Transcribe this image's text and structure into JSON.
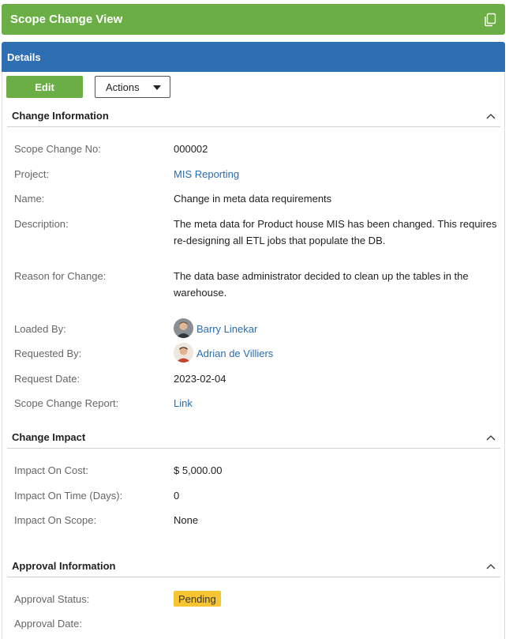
{
  "header": {
    "title": "Scope Change View",
    "copy_icon": "copy-icon"
  },
  "panel": {
    "title": "Details"
  },
  "toolbar": {
    "edit_label": "Edit",
    "actions_label": "Actions"
  },
  "sections": {
    "change_info": {
      "title": "Change Information",
      "rows": {
        "scope_change_no": {
          "label": "Scope Change No:",
          "value": "000002"
        },
        "project": {
          "label": "Project:",
          "value": "MIS Reporting"
        },
        "name": {
          "label": "Name:",
          "value": "Change in meta data requirements"
        },
        "description": {
          "label": "Description:",
          "value": "The meta data for Product house MIS has been changed. This requires re-designing all ETL jobs that populate the DB."
        },
        "reason": {
          "label": "Reason for Change:",
          "value": "The data base administrator decided to clean up the tables in the warehouse."
        },
        "loaded_by": {
          "label": "Loaded By:",
          "value": "Barry Linekar"
        },
        "requested_by": {
          "label": "Requested By:",
          "value": "Adrian de Villiers"
        },
        "request_date": {
          "label": "Request Date:",
          "value": "2023-02-04"
        },
        "report": {
          "label": "Scope Change Report:",
          "value": "Link"
        }
      }
    },
    "impact": {
      "title": "Change Impact",
      "rows": {
        "cost": {
          "label": "Impact On Cost:",
          "value": "$ 5,000.00"
        },
        "time": {
          "label": "Impact On Time (Days):",
          "value": "0"
        },
        "scope": {
          "label": "Impact On Scope:",
          "value": "None"
        }
      }
    },
    "approval": {
      "title": "Approval Information",
      "rows": {
        "status": {
          "label": "Approval Status:",
          "value": "Pending"
        },
        "date": {
          "label": "Approval Date:",
          "value": ""
        }
      }
    }
  },
  "colors": {
    "header_green": "#6aae45",
    "panel_blue": "#2e6eb2",
    "link_blue": "#2a6cb0",
    "pending_yellow": "#f7c531"
  }
}
